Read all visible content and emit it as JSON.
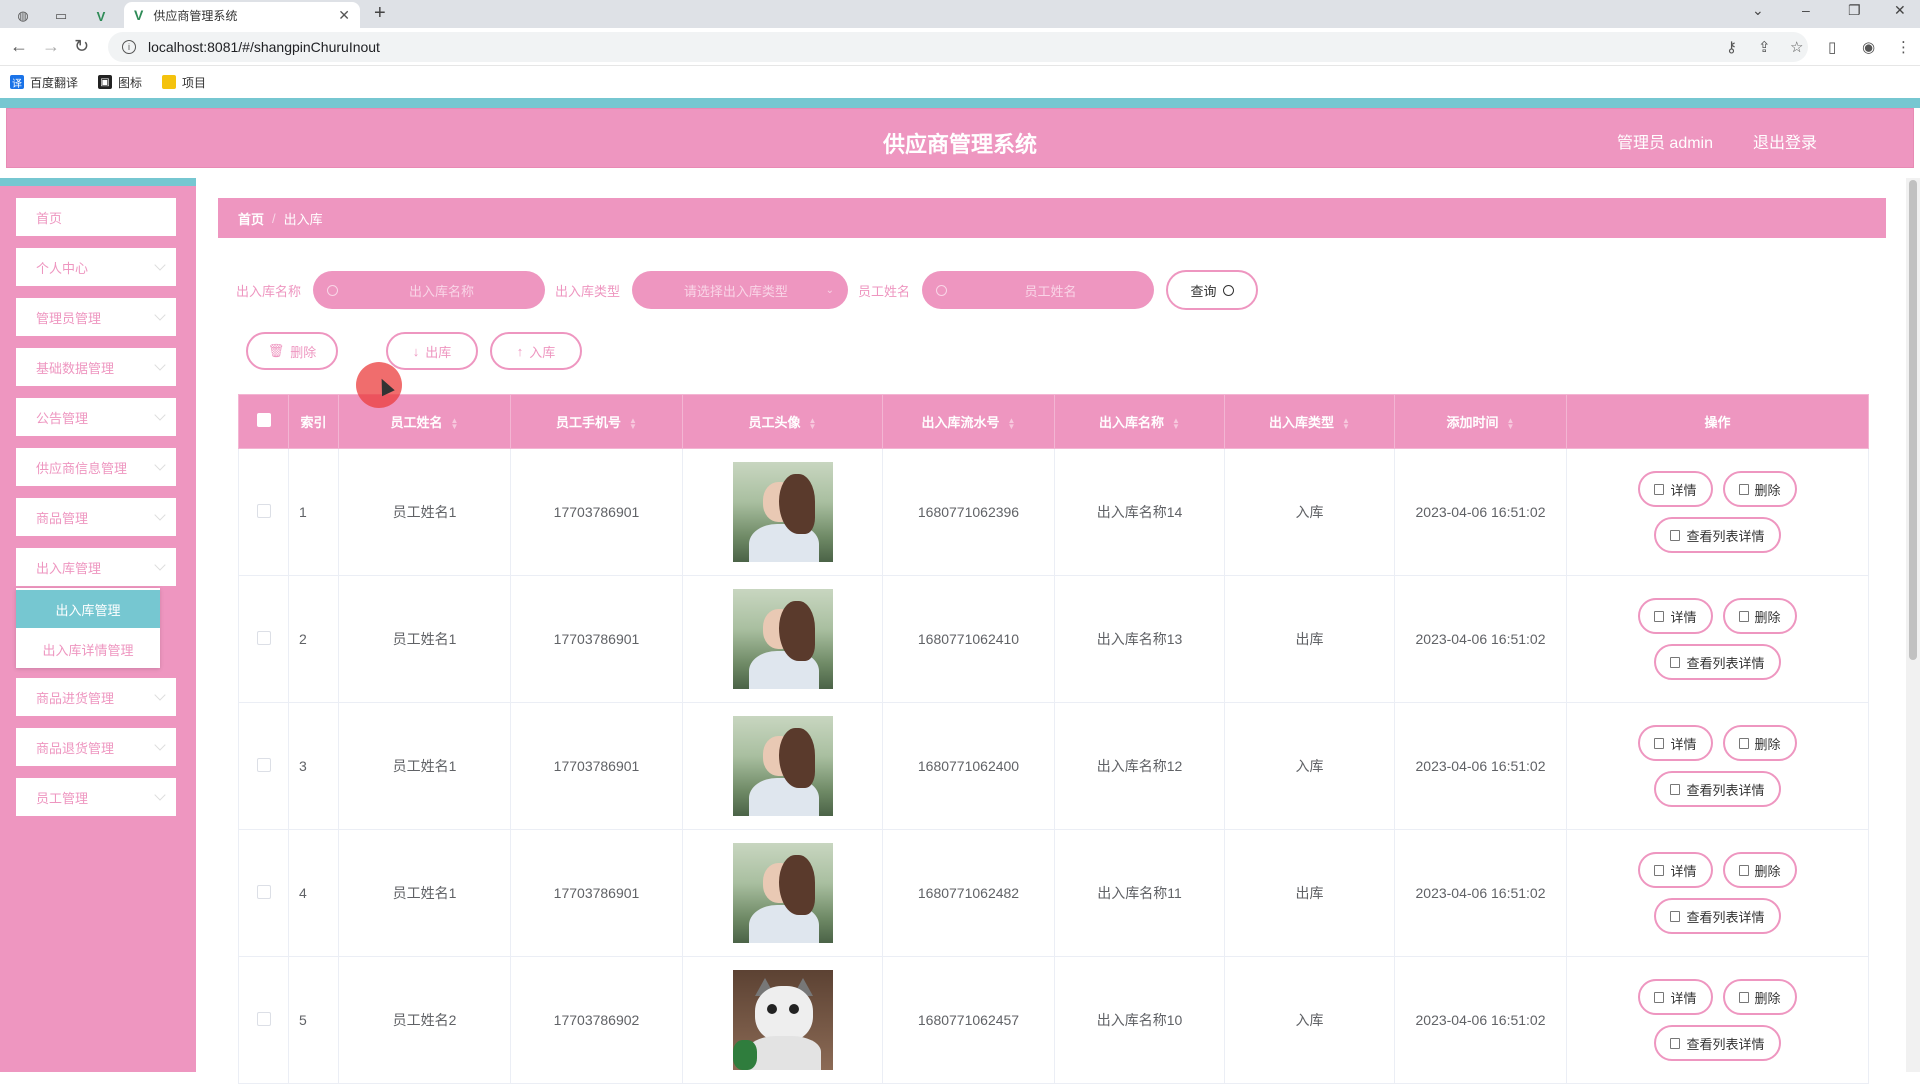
{
  "browser": {
    "active_tab_title": "供应商管理系统",
    "url": "localhost:8081/#/shangpinChuruInout",
    "bookmarks": [
      {
        "label": "百度翻译",
        "icon": "translate-icon",
        "color": "#1a73e8"
      },
      {
        "label": "图标",
        "icon": "picture-icon",
        "color": "#222222"
      },
      {
        "label": "项目",
        "icon": "folder-icon",
        "color": "#f4c20d"
      }
    ]
  },
  "header": {
    "title": "供应商管理系统",
    "user": "管理员 admin",
    "logout": "退出登录"
  },
  "sidebar": {
    "items": [
      {
        "label": "首页"
      },
      {
        "label": "个人中心"
      },
      {
        "label": "管理员管理"
      },
      {
        "label": "基础数据管理"
      },
      {
        "label": "公告管理"
      },
      {
        "label": "供应商信息管理"
      },
      {
        "label": "商品管理"
      },
      {
        "label": "出入库管理"
      },
      {
        "label": "商品进货管理"
      },
      {
        "label": "商品退货管理"
      },
      {
        "label": "员工管理"
      }
    ],
    "submenu": [
      {
        "label": "出入库管理",
        "active": true
      },
      {
        "label": "出入库详情管理",
        "active": false
      }
    ]
  },
  "breadcrumb": {
    "home": "首页",
    "current": "出入库"
  },
  "search": {
    "name_label": "出入库名称",
    "name_placeholder": "出入库名称",
    "type_label": "出入库类型",
    "type_placeholder": "请选择出入库类型",
    "staff_label": "员工姓名",
    "staff_placeholder": "员工姓名",
    "query_button": "查询"
  },
  "actions": {
    "delete": "删除",
    "out": "出库",
    "in": "入库"
  },
  "table": {
    "columns": [
      "索引",
      "员工姓名",
      "员工手机号",
      "员工头像",
      "出入库流水号",
      "出入库名称",
      "出入库类型",
      "添加时间",
      "操作"
    ],
    "rows": [
      {
        "index": "1",
        "name": "员工姓名1",
        "phone": "17703786901",
        "avatar": "girl",
        "serial": "1680771062396",
        "title": "出入库名称14",
        "type": "入库",
        "time": "2023-04-06 16:51:02"
      },
      {
        "index": "2",
        "name": "员工姓名1",
        "phone": "17703786901",
        "avatar": "girl",
        "serial": "1680771062410",
        "title": "出入库名称13",
        "type": "出库",
        "time": "2023-04-06 16:51:02"
      },
      {
        "index": "3",
        "name": "员工姓名1",
        "phone": "17703786901",
        "avatar": "girl",
        "serial": "1680771062400",
        "title": "出入库名称12",
        "type": "入库",
        "time": "2023-04-06 16:51:02"
      },
      {
        "index": "4",
        "name": "员工姓名1",
        "phone": "17703786901",
        "avatar": "girl",
        "serial": "1680771062482",
        "title": "出入库名称11",
        "type": "出库",
        "time": "2023-04-06 16:51:02"
      },
      {
        "index": "5",
        "name": "员工姓名2",
        "phone": "17703786902",
        "avatar": "cat",
        "serial": "1680771062457",
        "title": "出入库名称10",
        "type": "入库",
        "time": "2023-04-06 16:51:02"
      }
    ],
    "op_labels": {
      "detail": "详情",
      "delete": "删除",
      "list_detail": "查看列表详情"
    }
  },
  "colors": {
    "primary": "#ee96c0",
    "accent": "#76c7d1"
  }
}
